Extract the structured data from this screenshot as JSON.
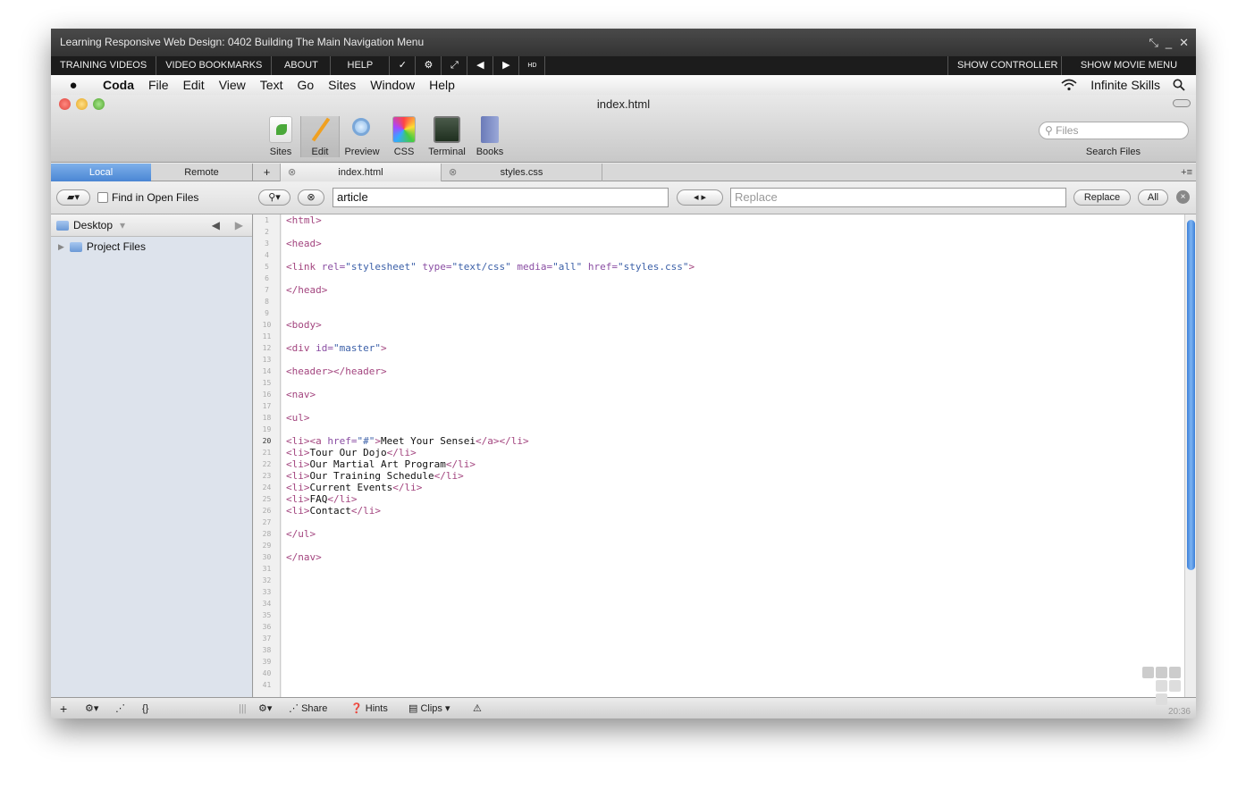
{
  "player": {
    "title": "Learning Responsive Web Design: 0402 Building The Main Navigation Menu",
    "window_controls": [
      "⤡",
      "_",
      "✕"
    ],
    "menu_buttons": [
      "TRAINING VIDEOS",
      "VIDEO BOOKMARKS",
      "ABOUT",
      "HELP"
    ],
    "icon_buttons": [
      "✓",
      "⚙",
      "⤢",
      "◀",
      "▶",
      "HD"
    ],
    "right_buttons": [
      "SHOW CONTROLLER",
      "SHOW MOVIE MENU"
    ]
  },
  "menubar": {
    "app": "Coda",
    "items": [
      "File",
      "Edit",
      "View",
      "Text",
      "Go",
      "Sites",
      "Window",
      "Help"
    ],
    "brand": "Infinite Skills"
  },
  "window": {
    "title": "index.html",
    "tools": [
      {
        "label": "Sites",
        "icon": "sites-icon"
      },
      {
        "label": "Edit",
        "icon": "pencil-icon"
      },
      {
        "label": "Preview",
        "icon": "magnifier-icon"
      },
      {
        "label": "CSS",
        "icon": "css-icon"
      },
      {
        "label": "Terminal",
        "icon": "terminal-icon"
      },
      {
        "label": "Books",
        "icon": "books-icon"
      }
    ],
    "search_placeholder": "Files",
    "search_label": "Search Files"
  },
  "tabs": {
    "local": "Local",
    "remote": "Remote",
    "add": "+",
    "docs": [
      "index.html",
      "styles.css"
    ]
  },
  "find": {
    "find_in_open_files": "Find in Open Files",
    "search_value": "article",
    "replace_placeholder": "Replace",
    "replace_label": "Replace",
    "all_label": "All"
  },
  "sidebar": {
    "location": "Desktop",
    "items": [
      "Project Files"
    ]
  },
  "editor": {
    "line_count": 41,
    "current_line": 20,
    "lines": [
      {
        "n": 1,
        "code": "<html>"
      },
      {
        "n": 3,
        "code": "<head>"
      },
      {
        "n": 5,
        "code": "<link rel=\"stylesheet\" type=\"text/css\" media=\"all\" href=\"styles.css\">"
      },
      {
        "n": 7,
        "code": "</head>"
      },
      {
        "n": 10,
        "code": "<body>"
      },
      {
        "n": 12,
        "code": "<div id=\"master\">"
      },
      {
        "n": 14,
        "code": "<header></header>"
      },
      {
        "n": 16,
        "code": "<nav>"
      },
      {
        "n": 18,
        "code": "<ul>"
      },
      {
        "n": 20,
        "code": "<li><a href=\"#\">Meet Your Sensei</a></li>"
      },
      {
        "n": 21,
        "code": "<li>Tour Our Dojo</li>"
      },
      {
        "n": 22,
        "code": "<li>Our Martial Art Program</li>"
      },
      {
        "n": 23,
        "code": "<li>Our Training Schedule</li>"
      },
      {
        "n": 24,
        "code": "<li>Current Events</li>"
      },
      {
        "n": 25,
        "code": "<li>FAQ</li>"
      },
      {
        "n": 26,
        "code": "<li>Contact</li>"
      },
      {
        "n": 28,
        "code": "</ul>"
      },
      {
        "n": 30,
        "code": "</nav>"
      }
    ]
  },
  "bottom": {
    "share": "Share",
    "hints": "Hints",
    "clips": "Clips",
    "time": "20:36"
  },
  "colors": {
    "tag": "#a3457f",
    "attr": "#8a4ea3",
    "value": "#3c60a8",
    "accent": "#4a86d4"
  }
}
